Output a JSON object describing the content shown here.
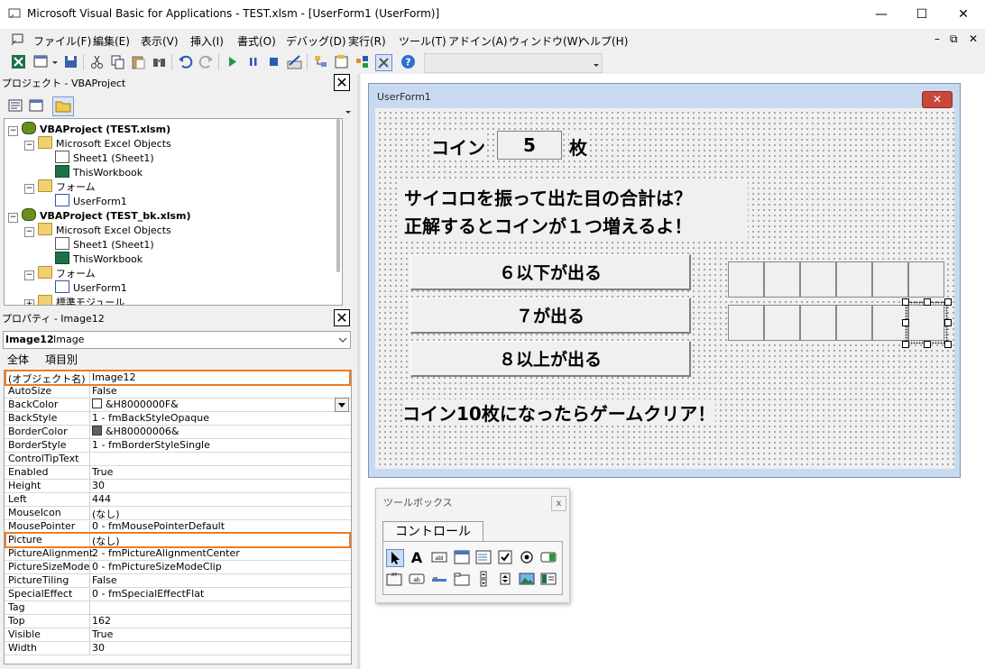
{
  "window": {
    "title": "Microsoft Visual Basic for Applications - TEST.xlsm - [UserForm1 (UserForm)]",
    "min_glyph": "—",
    "max_glyph": "☐",
    "close_glyph": "✕"
  },
  "menu": {
    "items": [
      "ファイル(F)",
      "編集(E)",
      "表示(V)",
      "挿入(I)",
      "書式(O)",
      "デバッグ(D)",
      "実行(R)",
      "ツール(T)",
      "アドイン(A)",
      "ウィンドウ(W)",
      "ヘルプ(H)"
    ],
    "mdi_min": "–",
    "mdi_restore": "⧉",
    "mdi_close": "✕"
  },
  "project_pane": {
    "title": "プロジェクト - VBAProject",
    "close_glyph": "✕",
    "tree": [
      {
        "label": "VBAProject (TEST.xlsm)",
        "level": 0,
        "kind": "project",
        "expander": "−"
      },
      {
        "label": "Microsoft Excel Objects",
        "level": 1,
        "kind": "folder",
        "expander": "−"
      },
      {
        "label": "Sheet1 (Sheet1)",
        "level": 2,
        "kind": "sheet"
      },
      {
        "label": "ThisWorkbook",
        "level": 2,
        "kind": "workbook"
      },
      {
        "label": "フォーム",
        "level": 1,
        "kind": "folder",
        "expander": "−"
      },
      {
        "label": "UserForm1",
        "level": 2,
        "kind": "form"
      },
      {
        "label": "VBAProject (TEST_bk.xlsm)",
        "level": 0,
        "kind": "project",
        "expander": "−"
      },
      {
        "label": "Microsoft Excel Objects",
        "level": 1,
        "kind": "folder",
        "expander": "−"
      },
      {
        "label": "Sheet1 (Sheet1)",
        "level": 2,
        "kind": "sheet"
      },
      {
        "label": "ThisWorkbook",
        "level": 2,
        "kind": "workbook"
      },
      {
        "label": "フォーム",
        "level": 1,
        "kind": "folder",
        "expander": "−"
      },
      {
        "label": "UserForm1",
        "level": 2,
        "kind": "form"
      },
      {
        "label": "標準モジュール",
        "level": 1,
        "kind": "folder",
        "expander": "+"
      }
    ]
  },
  "properties_pane": {
    "title": "プロパティ - Image12",
    "close_glyph": "✕",
    "object_name": "Image12",
    "object_type": "Image",
    "tab_all": "全体",
    "tab_category": "項目別",
    "rows": [
      {
        "name": "(オブジェクト名)",
        "value": "Image12",
        "highlight": true
      },
      {
        "name": "AutoSize",
        "value": "False"
      },
      {
        "name": "BackColor",
        "value": "&H8000000F&",
        "swatch": "#ffffff",
        "dropdown": true
      },
      {
        "name": "BackStyle",
        "value": "1 - fmBackStyleOpaque"
      },
      {
        "name": "BorderColor",
        "value": "&H80000006&",
        "swatch": "#606060"
      },
      {
        "name": "BorderStyle",
        "value": "1 - fmBorderStyleSingle"
      },
      {
        "name": "ControlTipText",
        "value": ""
      },
      {
        "name": "Enabled",
        "value": "True"
      },
      {
        "name": "Height",
        "value": "30"
      },
      {
        "name": "Left",
        "value": "444"
      },
      {
        "name": "MouseIcon",
        "value": "(なし)"
      },
      {
        "name": "MousePointer",
        "value": "0 - fmMousePointerDefault"
      },
      {
        "name": "Picture",
        "value": "(なし)",
        "highlight": true
      },
      {
        "name": "PictureAlignment",
        "value": "2 - fmPictureAlignmentCenter"
      },
      {
        "name": "PictureSizeMode",
        "value": "0 - fmPictureSizeModeClip"
      },
      {
        "name": "PictureTiling",
        "value": "False"
      },
      {
        "name": "SpecialEffect",
        "value": "0 - fmSpecialEffectFlat"
      },
      {
        "name": "Tag",
        "value": ""
      },
      {
        "name": "Top",
        "value": "162"
      },
      {
        "name": "Visible",
        "value": "True"
      },
      {
        "name": "Width",
        "value": "30"
      }
    ],
    "highlight_color": "#f07a20"
  },
  "userform": {
    "title": "UserForm1",
    "close_glyph": "✕",
    "coin_label": "コイン",
    "coin_value": "5",
    "coin_unit": "枚",
    "question_line1": "サイコロを振って出た目の合計は？",
    "question_line2": "正解するとコインが１つ増えるよ！",
    "buttons": [
      "６以下が出る",
      "７が出る",
      "８以上が出る"
    ],
    "clear_text": "コイン10枚になったらゲームクリア！"
  },
  "toolbox": {
    "title": "ツールボックス",
    "close_glyph": "x",
    "tab": "コントロール",
    "controls": [
      "pointer-icon",
      "label-icon",
      "textbox-icon",
      "combobox-icon",
      "listbox-icon",
      "checkbox-icon",
      "optionbutton-icon",
      "togglebutton-icon",
      "frame-icon",
      "commandbutton-icon",
      "tabstrip-icon",
      "multipage-icon",
      "scrollbar-icon",
      "spinbutton-icon",
      "image-icon",
      "refedit-icon"
    ]
  }
}
